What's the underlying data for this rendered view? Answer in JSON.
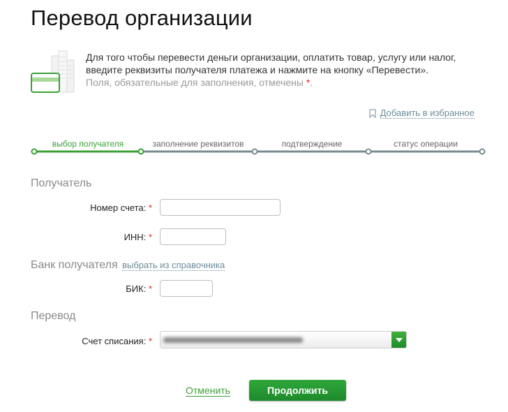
{
  "page": {
    "title": "Перевод организации"
  },
  "intro": {
    "line1": "Для того чтобы перевести деньги организации, оплатить товар, услугу или налог,",
    "line2": "введите реквизиты получателя платежа и нажмите на кнопку «Перевести».",
    "hint": "Поля, обязательные для заполнения, отмечены",
    "required_mark": "*",
    "illustration_icon": "card-and-buildings-icon"
  },
  "favorites": {
    "label": "Добавить в избранное",
    "icon": "bookmark-icon"
  },
  "steps": [
    {
      "label": "выбор получателя",
      "state": "active"
    },
    {
      "label": "заполнение реквизитов",
      "state": "pending"
    },
    {
      "label": "подтверждение",
      "state": "pending"
    },
    {
      "label": "статус операции",
      "state": "pending"
    }
  ],
  "sections": {
    "recipient": {
      "title": "Получатель",
      "account_label": "Номер счета:",
      "inn_label": "ИНН:",
      "account_value": "",
      "inn_value": ""
    },
    "bank": {
      "title": "Банк получателя",
      "directory_link": "выбрать из справочника",
      "bik_label": "БИК:",
      "bik_value": ""
    },
    "transfer": {
      "title": "Перевод",
      "debit_label": "Счет списания:"
    }
  },
  "actions": {
    "cancel": "Отменить",
    "continue": "Продолжить"
  },
  "colors": {
    "accent": "#3aa035",
    "required": "#e2231a",
    "link": "#6c8c99",
    "progress_line": "#7a8a92"
  }
}
